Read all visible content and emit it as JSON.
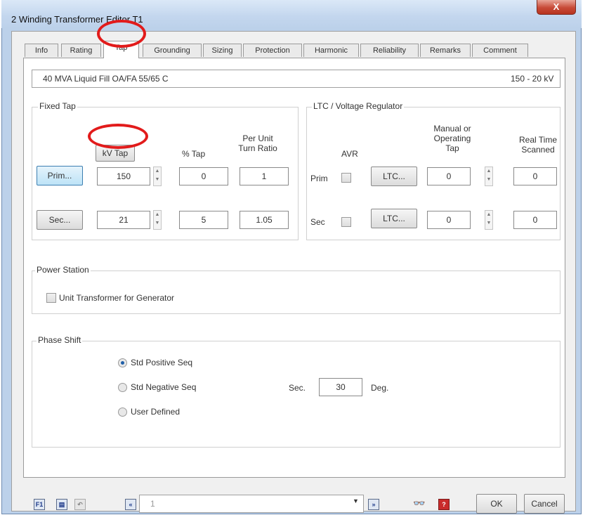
{
  "window": {
    "title": "2 Winding Transformer Editor   T1",
    "close_glyph": "X"
  },
  "tabs": [
    {
      "label": "Info"
    },
    {
      "label": "Rating"
    },
    {
      "label": "Tap"
    },
    {
      "label": "Grounding"
    },
    {
      "label": "Sizing"
    },
    {
      "label": "Protection"
    },
    {
      "label": "Harmonic"
    },
    {
      "label": "Reliability"
    },
    {
      "label": "Remarks"
    },
    {
      "label": "Comment"
    }
  ],
  "active_tab": "Tap",
  "info_bar": {
    "description": "40 MVA  Liquid Fill  OA/FA  55/65 C",
    "voltage": "150 - 20 kV"
  },
  "fixed_tap": {
    "legend": "Fixed Tap",
    "kv_tap_button": "kV Tap",
    "pct_tap_header": "% Tap",
    "per_unit_header": "Per Unit\nTurn Ratio",
    "prim": {
      "button": "Prim...",
      "kv": "150",
      "pct": "0",
      "ratio": "1"
    },
    "sec": {
      "button": "Sec...",
      "kv": "21",
      "pct": "5",
      "ratio": "1.05"
    }
  },
  "ltc": {
    "legend": "LTC / Voltage Regulator",
    "avr_header": "AVR",
    "manual_header": "Manual or\nOperating\nTap",
    "realtime_header": "Real Time\nScanned",
    "prim": {
      "label": "Prim",
      "button": "LTC...",
      "manual": "0",
      "realtime": "0"
    },
    "sec": {
      "label": "Sec",
      "button": "LTC...",
      "manual": "0",
      "realtime": "0"
    }
  },
  "power_station": {
    "legend": "Power Station",
    "checkbox_label": "Unit Transformer for Generator"
  },
  "phase_shift": {
    "legend": "Phase Shift",
    "options": [
      {
        "label": "Std Positive Seq",
        "selected": true
      },
      {
        "label": "Std Negative Seq",
        "selected": false
      },
      {
        "label": "User Defined",
        "selected": false
      }
    ],
    "sec_label": "Sec.",
    "sec_value": "30",
    "deg_label": "Deg."
  },
  "footer": {
    "nav_value": "1",
    "ok_label": "OK",
    "cancel_label": "Cancel"
  },
  "colors": {
    "title_bar": "#c3d6ee",
    "close_button": "#c74a37",
    "annotation_ring": "#e21b1b"
  }
}
